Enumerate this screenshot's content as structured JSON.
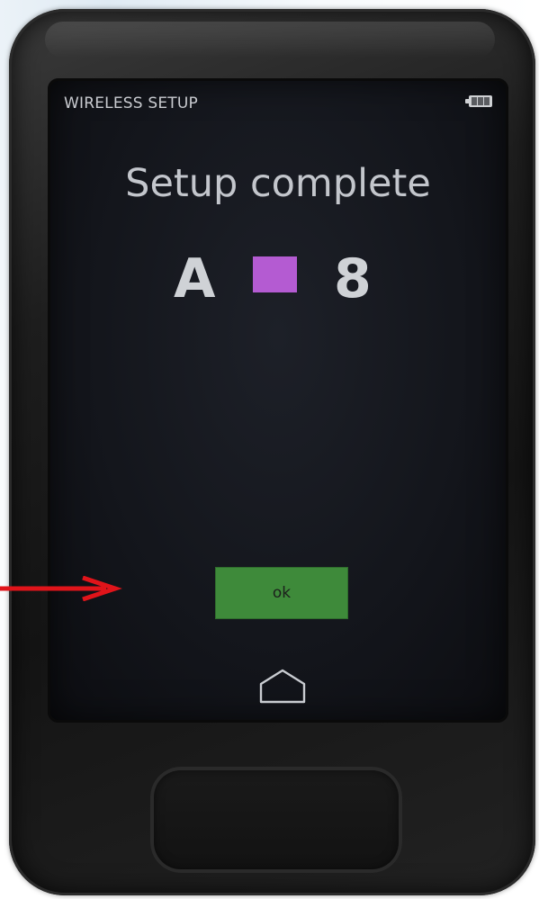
{
  "status_bar": {
    "title": "WIRELESS SETUP",
    "battery_icon": "battery-full-icon"
  },
  "main": {
    "title": "Setup complete",
    "pairing_code": {
      "letter": "A",
      "color": "#b45bd2",
      "number": "8"
    }
  },
  "actions": {
    "ok_label": "ok"
  },
  "navigation": {
    "home_icon": "home-icon"
  },
  "annotation": {
    "arrow_color": "#e0141a",
    "arrow_icon": "arrow-right-icon"
  }
}
